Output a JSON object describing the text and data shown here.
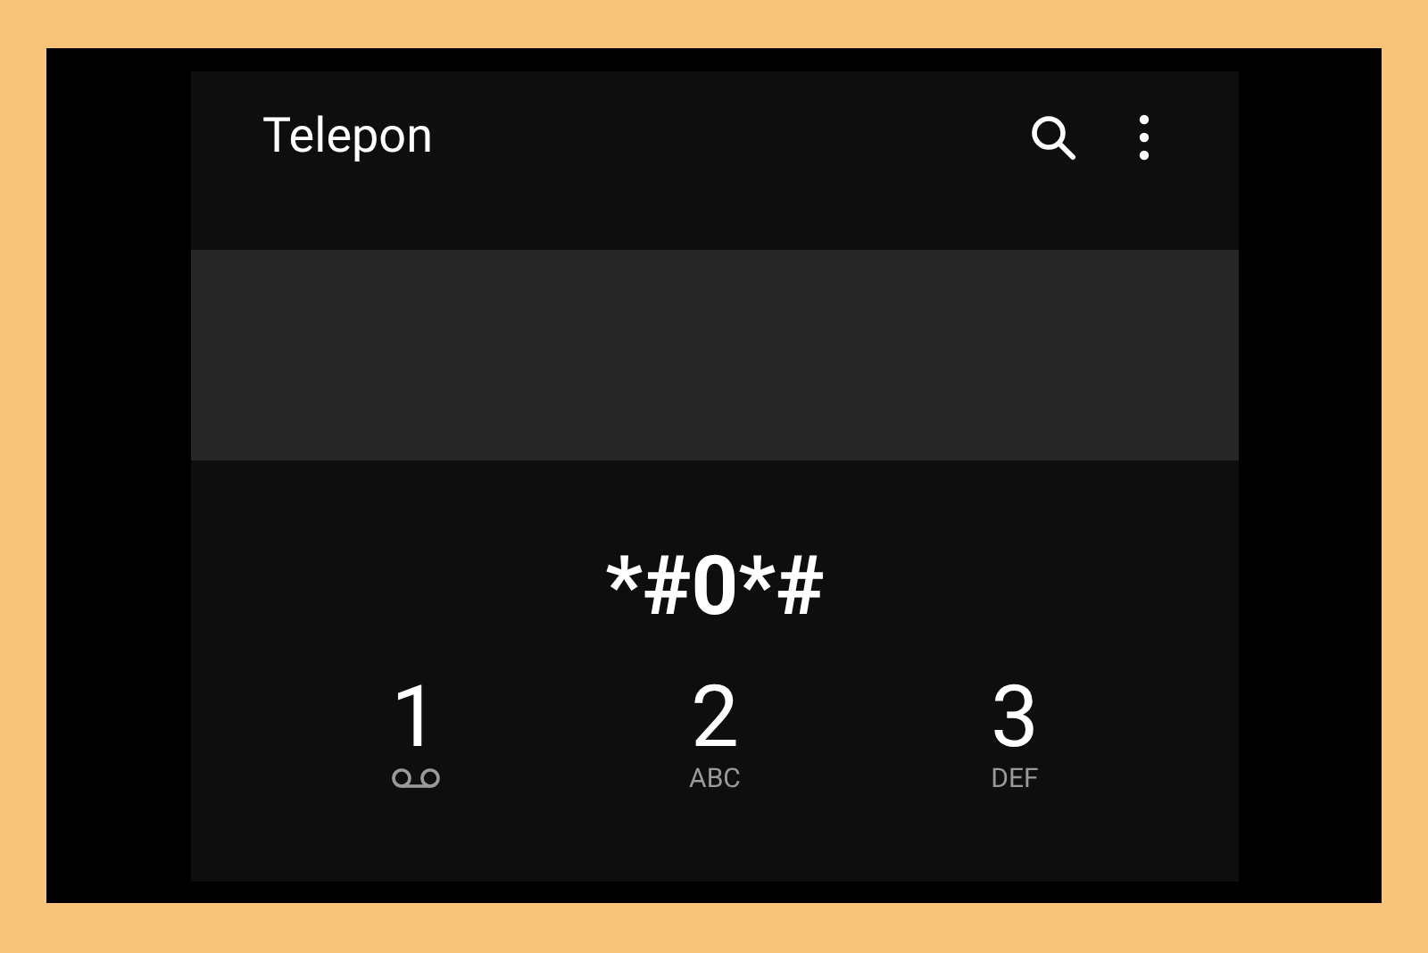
{
  "app_bar": {
    "title": "Telepon"
  },
  "dialed_number": "*#0*#",
  "keys": [
    {
      "digit": "1",
      "kind": "voicemail"
    },
    {
      "digit": "2",
      "kind": "letters",
      "letters": "ABC"
    },
    {
      "digit": "3",
      "kind": "letters",
      "letters": "DEF"
    }
  ]
}
